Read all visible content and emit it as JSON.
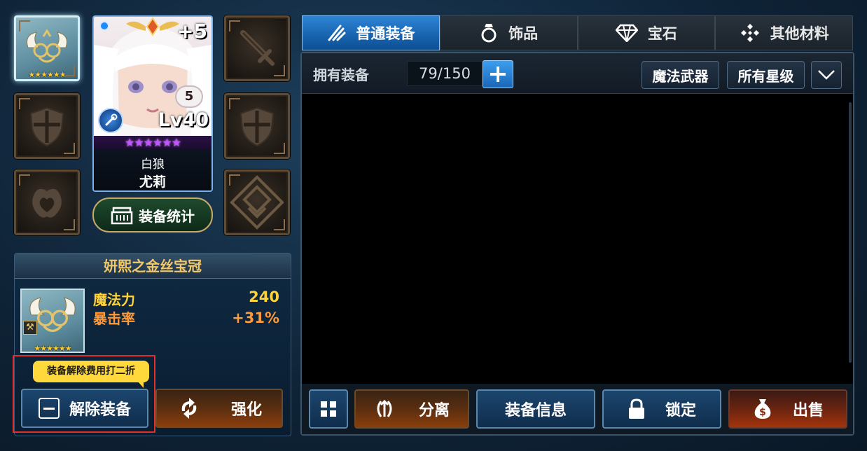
{
  "hero": {
    "enhance": "+5",
    "level": "Lv40",
    "rank_badge": "5",
    "star_count": 6,
    "title": "白狼",
    "name": "尤莉"
  },
  "stats_button": {
    "label": "装备统计",
    "icon": "chest-icon"
  },
  "equipment_slots": [
    {
      "slot": "helmet",
      "equipped": true,
      "stars": 6,
      "icon": "winged-crown-icon"
    },
    {
      "slot": "weapon",
      "equipped": false,
      "icon": "sword-icon"
    },
    {
      "slot": "armor-left",
      "equipped": false,
      "icon": "shield-icon"
    },
    {
      "slot": "armor-right",
      "equipped": false,
      "icon": "shield-icon"
    },
    {
      "slot": "accessory",
      "equipped": false,
      "icon": "ring-icon"
    },
    {
      "slot": "gem",
      "equipped": false,
      "icon": "gem-diamond-icon"
    }
  ],
  "item": {
    "name": "妍熙之金丝宝冠",
    "stars": 6,
    "stats": [
      {
        "label": "魔法力",
        "value": "240"
      },
      {
        "label": "暴击率",
        "value": "+31%"
      }
    ]
  },
  "tooltip": {
    "text": "装备解除费用打二折"
  },
  "actions": {
    "unequip": "解除装备",
    "enhance": "强化"
  },
  "tabs": [
    {
      "label": "普通装备",
      "icon": "sword-slash-icon",
      "active": true
    },
    {
      "label": "饰品",
      "icon": "ring-icon",
      "active": false
    },
    {
      "label": "宝石",
      "icon": "gem-icon",
      "active": false
    },
    {
      "label": "其他材料",
      "icon": "materials-icon",
      "active": false
    }
  ],
  "inventory": {
    "header_label": "拥有装备",
    "count": "79/150",
    "filter_type": "魔法武器",
    "filter_star": "所有星级"
  },
  "footer_actions": {
    "separate": "分离",
    "info": "装备信息",
    "lock": "锁定",
    "sell": "出售"
  },
  "colors": {
    "accent_blue": "#1763ae",
    "gold_text": "#f1c86a",
    "stat_label": "#ffd23a",
    "stat_value_orange": "#ff9a3a",
    "highlight_red": "#e0302e",
    "tooltip_yellow": "#ffd93b"
  }
}
